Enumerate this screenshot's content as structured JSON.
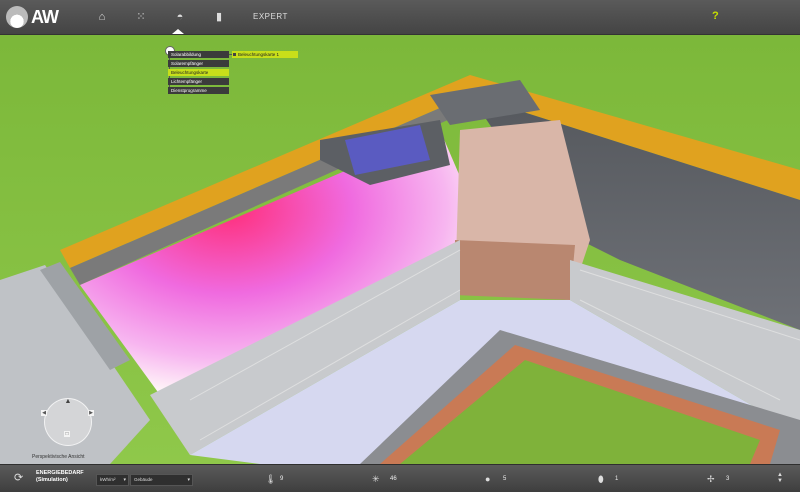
{
  "app": {
    "logo_text": "AW"
  },
  "nav": {
    "expert_label": "EXPERT",
    "help_label": "?"
  },
  "tree": {
    "items": [
      "Solarabbildung",
      "Solarempfänger",
      "Beleuchtungskarte",
      "Lichtempfänger",
      "Dienstprogramme"
    ],
    "selected_chip": "Beleuchtungskarte 1"
  },
  "view": {
    "label": "Perspektivische Ansicht"
  },
  "bottom": {
    "title_line1": "ENERGIEBEDARF",
    "title_line2": "(Simulation)",
    "unit_select": "kWh/m²",
    "scope_select": "Gebäude",
    "metrics": [
      {
        "icon": "thermometer-icon",
        "value": "9"
      },
      {
        "icon": "sun-icon",
        "value": "46"
      },
      {
        "icon": "bulb-icon",
        "value": "5"
      },
      {
        "icon": "drop-icon",
        "value": "1"
      },
      {
        "icon": "fan-icon",
        "value": "3"
      }
    ]
  }
}
